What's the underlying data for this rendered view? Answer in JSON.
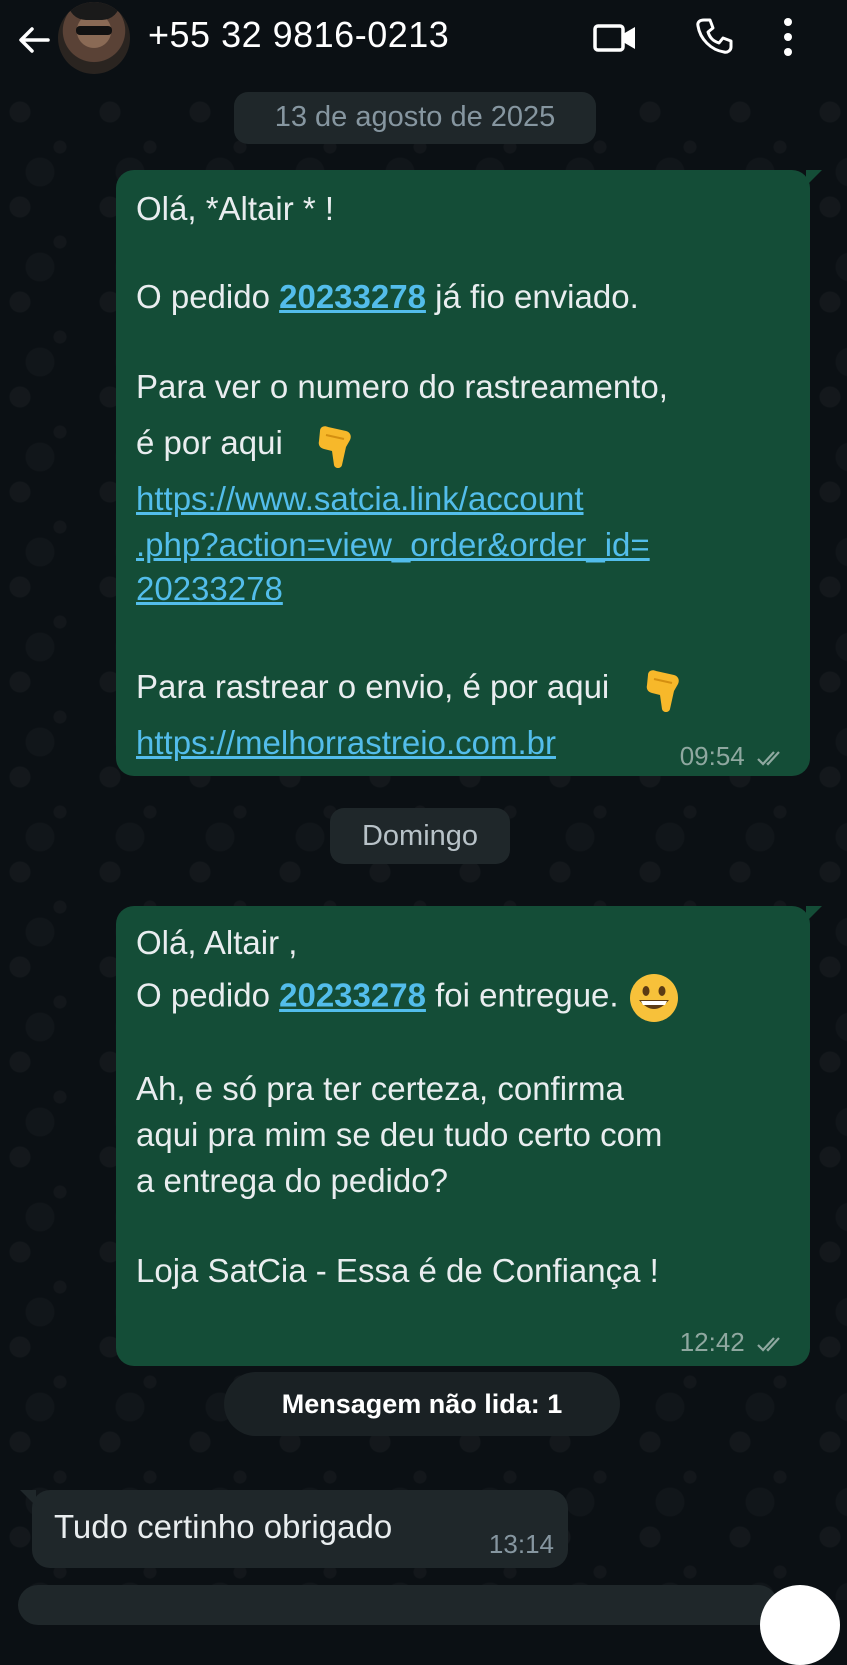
{
  "header": {
    "contact": "+55 32 9816-0213",
    "icons": [
      "back-arrow-icon",
      "video-call-icon",
      "voice-call-icon",
      "more-vert-icon"
    ]
  },
  "dates": {
    "first": "13 de agosto de 2025",
    "second": "Domingo"
  },
  "messages": [
    {
      "direction": "outgoing",
      "greeting": "Olá, *Altair * !",
      "order_prefix": "O pedido ",
      "order_id": "20233278",
      "order_suffix": " já fio enviado.",
      "tracking_line1": "Para ver o numero do rastreamento,",
      "tracking_line2": "é por aqui",
      "link1_line1": "https://www.satcia.link/account",
      "link1_line2": ".php?action=view_order&order_id=",
      "link1_line3": "20233278",
      "track_line": "Para rastrear o envio, é por aqui",
      "link2": "https://melhorrastreio.com.br",
      "time": "09:54",
      "status": "delivered"
    },
    {
      "direction": "outgoing",
      "greeting": "Olá, Altair ,",
      "order_prefix": "O pedido ",
      "order_id": "20233278",
      "order_suffix": " foi entregue.",
      "line3": "Ah, e só pra ter certeza, confirma",
      "line4": "aqui pra mim se deu tudo certo com",
      "line5": "a entrega do pedido?",
      "line6": "Loja SatCia - Essa é de Confiança !",
      "time": "12:42",
      "status": "delivered"
    },
    {
      "direction": "incoming",
      "text": "Tudo certinho obrigado",
      "time": "13:14"
    }
  ],
  "unread_banner": "Mensagem não lida: 1",
  "colors": {
    "background": "#0b1014",
    "outgoing_bubble": "#144d37",
    "incoming_bubble": "#1f272a",
    "link": "#53bdeb"
  }
}
